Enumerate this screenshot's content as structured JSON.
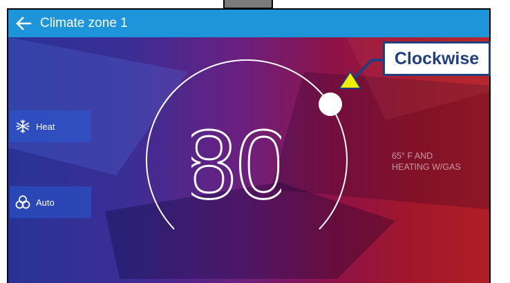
{
  "header": {
    "title": "Climate zone 1"
  },
  "modes": [
    {
      "label": "Heat",
      "icon": "snowflake-sun-icon"
    },
    {
      "label": "Auto",
      "icon": "fan-icon"
    }
  ],
  "thermostat": {
    "setpoint": "80",
    "status_lines": [
      "65° F AND",
      "HEATING W/GAS"
    ]
  },
  "annotation": {
    "label": "Clockwise"
  },
  "colors": {
    "appbar": "#1e95da",
    "callout_border": "#1f3f7f",
    "arrow": "#f2ee00"
  }
}
